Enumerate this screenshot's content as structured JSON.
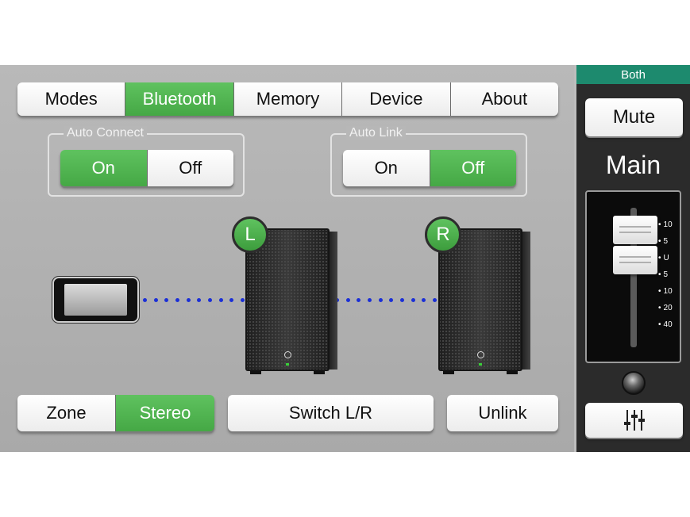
{
  "tabs": [
    {
      "label": "Modes",
      "active": false
    },
    {
      "label": "Bluetooth",
      "active": true
    },
    {
      "label": "Memory",
      "active": false
    },
    {
      "label": "Device",
      "active": false
    },
    {
      "label": "About",
      "active": false
    }
  ],
  "auto_connect": {
    "label": "Auto Connect",
    "on_label": "On",
    "off_label": "Off",
    "selected": "On"
  },
  "auto_link": {
    "label": "Auto Link",
    "on_label": "On",
    "off_label": "Off",
    "selected": "Off"
  },
  "speakers": {
    "left_badge": "L",
    "right_badge": "R"
  },
  "bottom": {
    "zone_label": "Zone",
    "stereo_label": "Stereo",
    "selected": "Stereo",
    "switch_label": "Switch L/R",
    "unlink_label": "Unlink"
  },
  "sidebar": {
    "target": "Both",
    "mute_label": "Mute",
    "channel_label": "Main",
    "fader_scale": [
      "10",
      "5",
      "U",
      "5",
      "10",
      "20",
      "40"
    ]
  },
  "colors": {
    "active_green": "#4cb04c",
    "teal_bar": "#1d8a6e",
    "dot_blue": "#1b2fd6"
  },
  "icons": {
    "fader_settings": "sliders-icon"
  }
}
